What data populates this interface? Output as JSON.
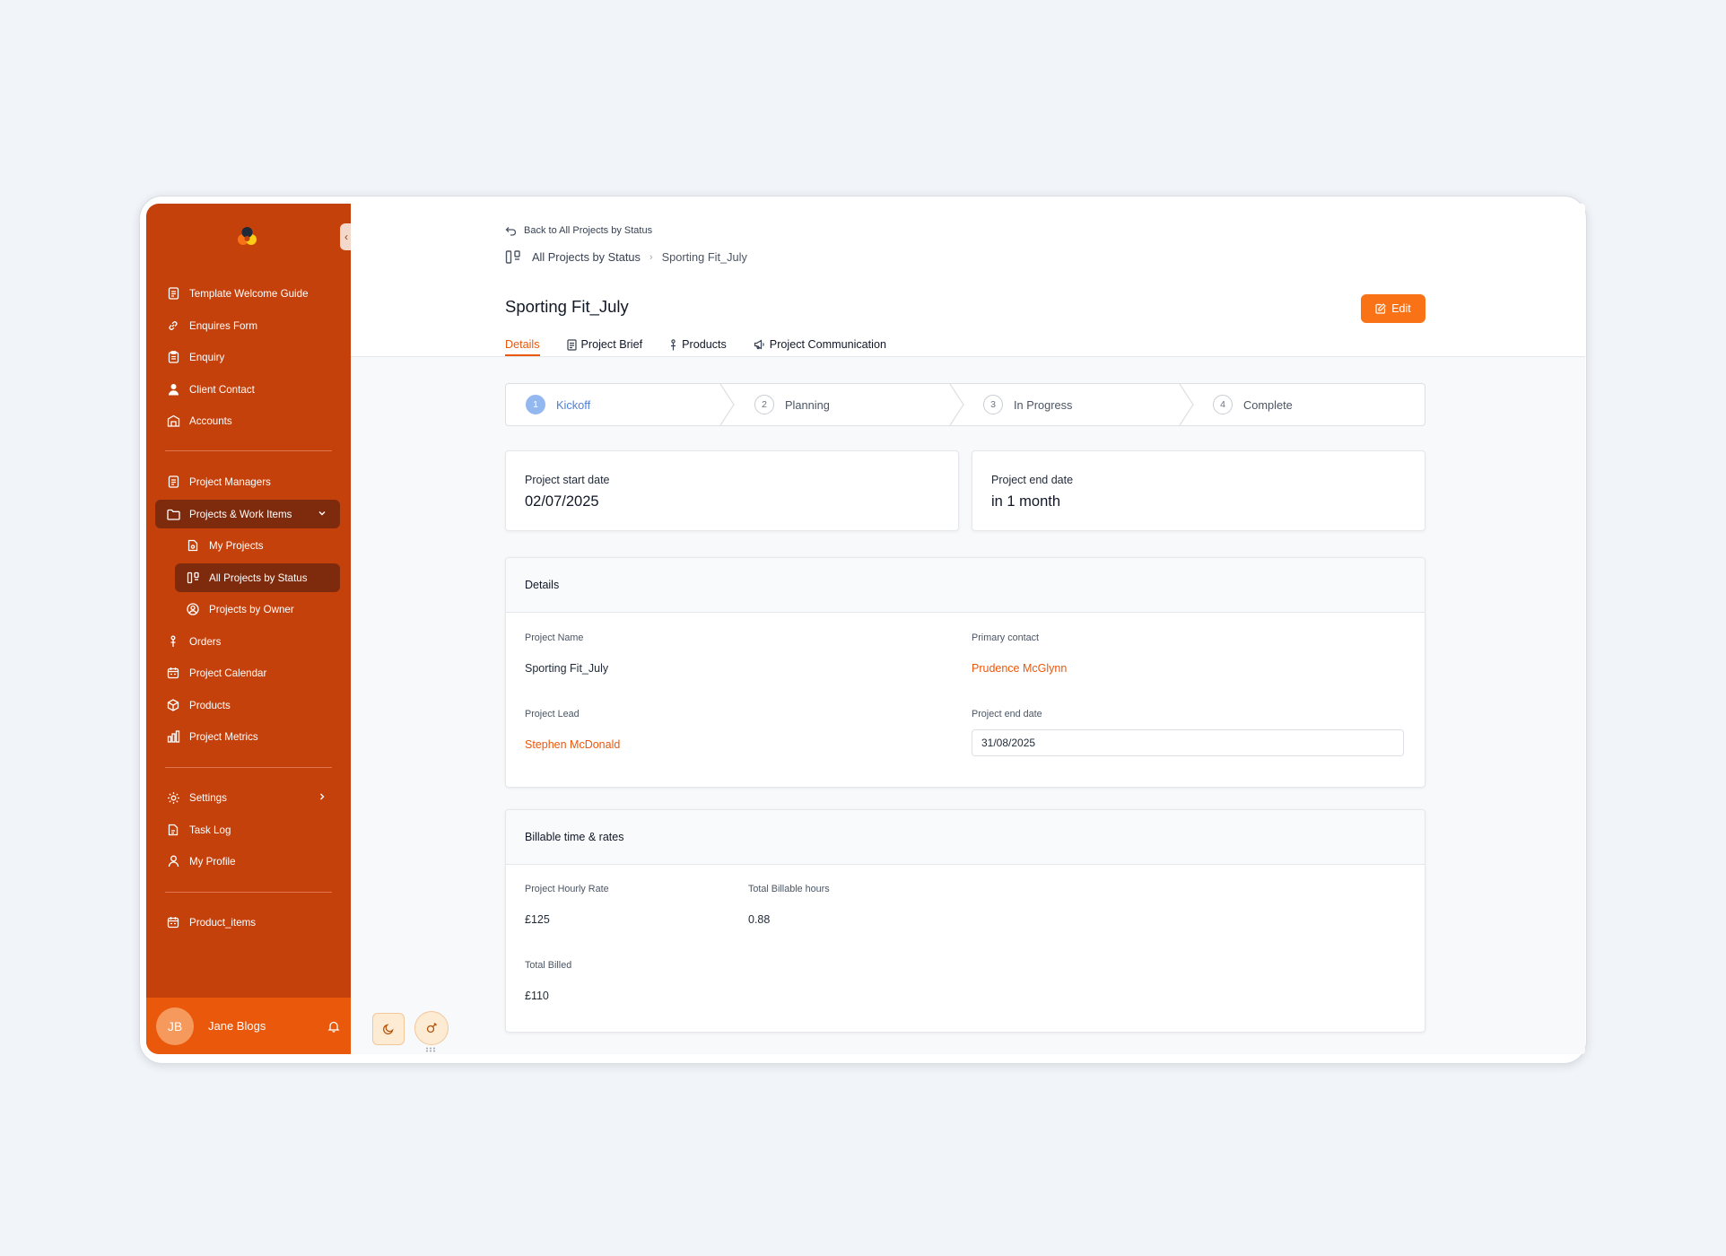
{
  "sidebar": {
    "collapse_glyph": "‹",
    "items": [
      {
        "label": "Template Welcome Guide",
        "icon": "document-icon"
      },
      {
        "label": "Enquires Form",
        "icon": "link-icon"
      },
      {
        "label": "Enquiry",
        "icon": "clipboard-icon"
      },
      {
        "label": "Client Contact",
        "icon": "user-filled-icon"
      },
      {
        "label": "Accounts",
        "icon": "building-icon"
      },
      {
        "label": "Project Managers",
        "icon": "document-icon"
      },
      {
        "label": "Projects & Work Items",
        "icon": "folder-icon"
      },
      {
        "label": "My Projects",
        "icon": "file-icon"
      },
      {
        "label": "All Projects by Status",
        "icon": "kanban-icon"
      },
      {
        "label": "Projects by Owner",
        "icon": "user-circle-icon"
      },
      {
        "label": "Orders",
        "icon": "pin-icon"
      },
      {
        "label": "Project Calendar",
        "icon": "calendar-icon"
      },
      {
        "label": "Products",
        "icon": "box-icon"
      },
      {
        "label": "Project Metrics",
        "icon": "chart-icon"
      },
      {
        "label": "Settings",
        "icon": "gear-icon"
      },
      {
        "label": "Task Log",
        "icon": "file-icon"
      },
      {
        "label": "My Profile",
        "icon": "user-outline-icon"
      },
      {
        "label": "Product_items",
        "icon": "calendar-icon"
      }
    ],
    "user": {
      "initials": "JB",
      "name": "Jane Blogs"
    }
  },
  "header": {
    "back_label": "Back to All Projects by Status",
    "breadcrumb": {
      "parent": "All Projects by Status",
      "separator": "›",
      "current": "Sporting Fit_July"
    },
    "title": "Sporting Fit_July",
    "edit_label": "Edit",
    "tabs": [
      {
        "label": "Details",
        "active": true
      },
      {
        "label": "Project Brief"
      },
      {
        "label": "Products"
      },
      {
        "label": "Project Communication"
      }
    ]
  },
  "stepper": [
    {
      "num": "1",
      "label": "Kickoff",
      "active": true
    },
    {
      "num": "2",
      "label": "Planning"
    },
    {
      "num": "3",
      "label": "In Progress"
    },
    {
      "num": "4",
      "label": "Complete"
    }
  ],
  "dates": {
    "start_label": "Project start date",
    "start_value": "02/07/2025",
    "end_label": "Project end date",
    "end_value": "in 1 month"
  },
  "details": {
    "title": "Details",
    "project_name_label": "Project Name",
    "project_name": "Sporting Fit_July",
    "primary_contact_label": "Primary contact",
    "primary_contact": "Prudence McGlynn",
    "project_lead_label": "Project Lead",
    "project_lead": "Stephen McDonald",
    "end_date_label": "Project end date",
    "end_date": "31/08/2025"
  },
  "billing": {
    "title": "Billable time & rates",
    "hourly_rate_label": "Project Hourly Rate",
    "hourly_rate": "£125",
    "billable_hours_label": "Total Billable hours",
    "billable_hours": "0.88",
    "total_billed_label": "Total Billed",
    "total_billed": "£110"
  },
  "colors": {
    "sidebar": "#c5410c",
    "accent": "#ea580c",
    "active_nav": "#7e2a0d",
    "step_active": "#4f7fd6"
  }
}
